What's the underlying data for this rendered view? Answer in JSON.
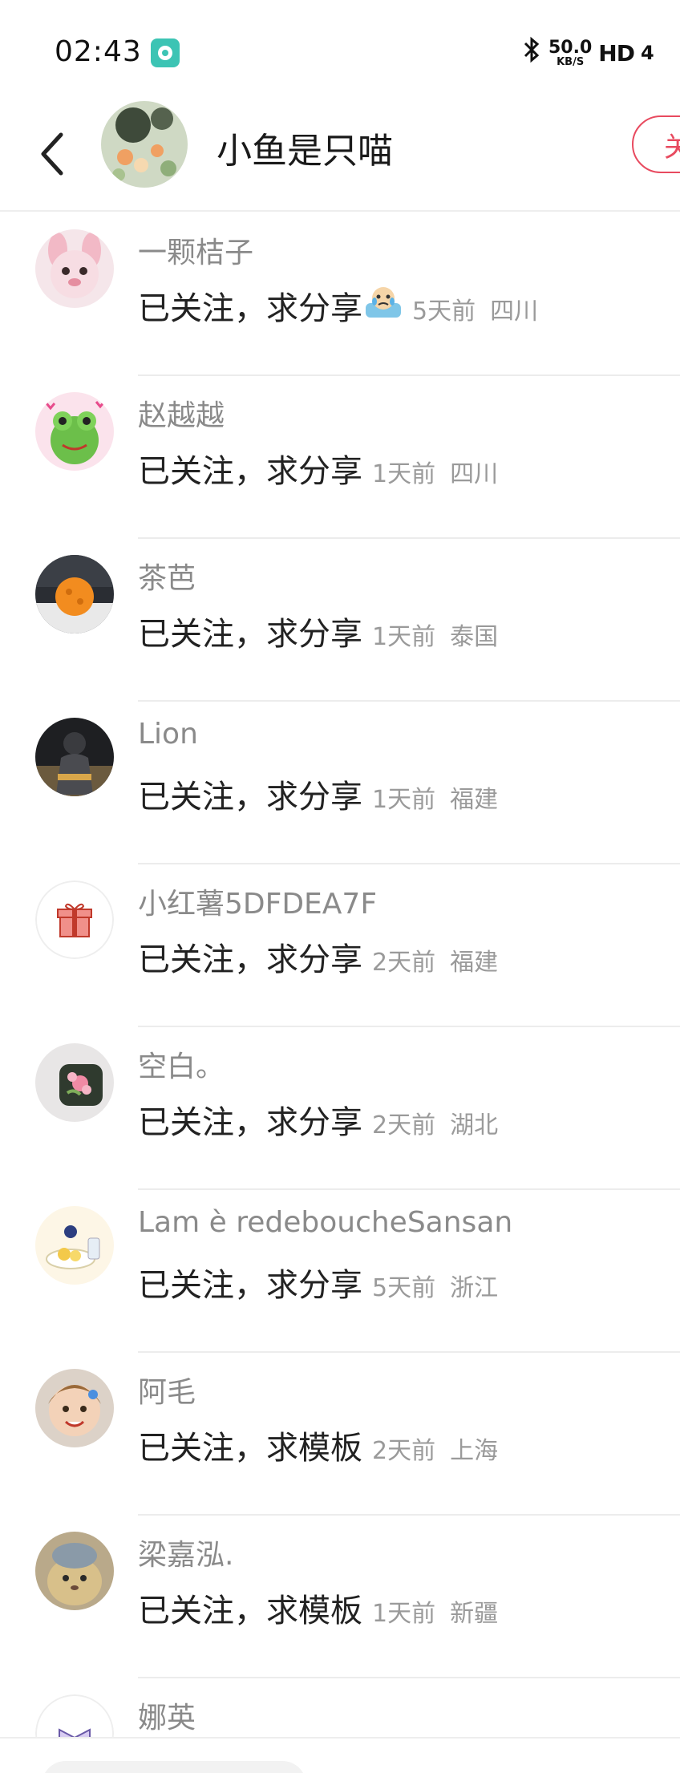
{
  "status_bar": {
    "time": "02:43",
    "net_speed_value": "50.0",
    "net_speed_unit": "KB/S",
    "hd_label": "HD",
    "signal_fragment": "4",
    "bluetooth_icon": "bluetooth-icon",
    "app_icon": "music-app-icon"
  },
  "header": {
    "title": "小鱼是只喵",
    "follow_label": "关",
    "back_icon": "chevron-left-icon",
    "accent_color": "#e84a5f"
  },
  "comments": [
    {
      "username": "一颗桔子",
      "text": "已关注，求分享",
      "emoji": "crying-emoji",
      "time": "5天前",
      "region": "四川"
    },
    {
      "username": "赵越越",
      "text": "已关注，求分享",
      "time": "1天前",
      "region": "四川"
    },
    {
      "username": "茶芭",
      "text": "已关注，求分享",
      "time": "1天前",
      "region": "泰国"
    },
    {
      "username": "Lion",
      "text": "已关注，求分享",
      "time": "1天前",
      "region": "福建"
    },
    {
      "username": "小红薯5DFDEA7F",
      "text": "已关注，求分享",
      "time": "2天前",
      "region": "福建"
    },
    {
      "username": "空白。",
      "text": "已关注，求分享",
      "time": "2天前",
      "region": "湖北"
    },
    {
      "username": "Lam è redeboucheSansan",
      "text": "已关注，求分享",
      "time": "5天前",
      "region": "浙江"
    },
    {
      "username": "阿毛",
      "text": "已关注，求模板",
      "time": "2天前",
      "region": "上海"
    },
    {
      "username": "梁嘉泓.",
      "text": "已关注，求模板",
      "time": "1天前",
      "region": "新疆"
    }
  ],
  "partial_comment": {
    "username": "娜英"
  }
}
